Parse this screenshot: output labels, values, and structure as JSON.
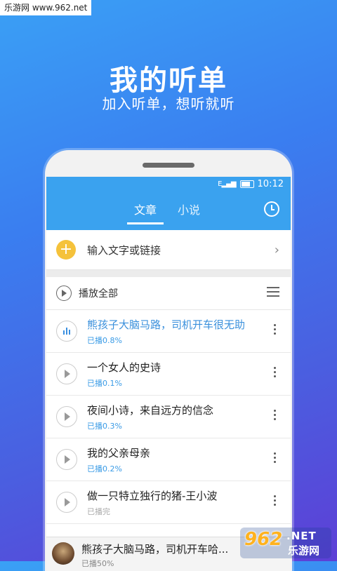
{
  "watermark": "乐游网 www.962.net",
  "hero": {
    "title": "我的听单",
    "subtitle": "加入听单，想听就听"
  },
  "status_bar": {
    "signal": "E",
    "time": "10:12"
  },
  "tabs": [
    {
      "label": "文章",
      "active": true
    },
    {
      "label": "小说",
      "active": false
    }
  ],
  "input_row": {
    "label": "输入文字或链接"
  },
  "play_all": {
    "label": "播放全部"
  },
  "items": [
    {
      "title": "熊孩子大脑马路，司机开车很无助",
      "progress": "已播0.8%",
      "playing": true
    },
    {
      "title": "一个女人的史诗",
      "progress": "已播0.1%",
      "playing": false
    },
    {
      "title": "夜间小诗，来自远方的信念",
      "progress": "已播0.3%",
      "playing": false
    },
    {
      "title": "我的父亲母亲",
      "progress": "已播0.2%",
      "playing": false
    },
    {
      "title": "做一只特立独行的猪-王小波",
      "progress": "已播完",
      "playing": false
    }
  ],
  "mini_player": {
    "title": "熊孩子大脑马路，司机开车哈...",
    "progress": "已播50%"
  },
  "logo": {
    "main": "962",
    "suffix": ".NET",
    "cn": "乐游网"
  },
  "colors": {
    "accent": "#3aa2ef",
    "active_title": "#3a90dc",
    "plus_button": "#f5c23b"
  }
}
